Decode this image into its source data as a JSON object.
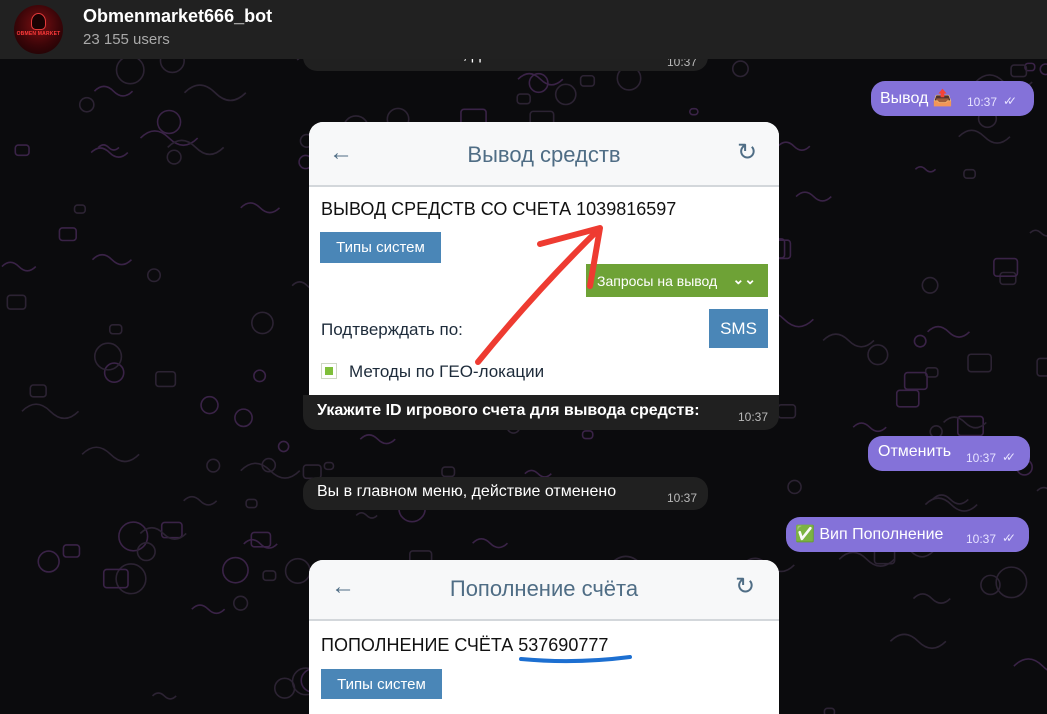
{
  "header": {
    "chat_title": "Obmenmarket666_bot",
    "members": "23 155 users",
    "avatar_text": "OBMEN MARKET"
  },
  "messages": {
    "m0_partial": "Вы в главном меню, действие отменено",
    "m0_time": "10:37",
    "m1_text": "Вывод 📤",
    "m1_time": "10:37",
    "caption_text": "Укажите ID игрового счета для вывода средств:",
    "caption_time": "10:37",
    "m3_text": "Отменить",
    "m3_time": "10:37",
    "m4_text": "Вы в главном меню, действие отменено",
    "m4_time": "10:37",
    "m5_text": "✅ Вип Пополнение",
    "m5_time": "10:37"
  },
  "withdraw_screen": {
    "title": "Вывод средств",
    "heading": "ВЫВОД СРЕДСТВ СО СЧЕТА 1039816597",
    "types_button": "Типы систем",
    "requests_button": "Запросы на вывод",
    "confirm_label": "Подтверждать по:",
    "sms_button": "SMS",
    "geo_label": "Методы по ГЕО-локации"
  },
  "deposit_screen": {
    "title": "Пополнение счёта",
    "heading_prefix": "ПОПОЛНЕНИЕ СЧЁТА ",
    "account_id": "537690777",
    "types_button": "Типы систем"
  },
  "icons": {
    "back": "arrow-left-icon",
    "refresh": "refresh-icon",
    "chevron": "double-chevron-down-icon",
    "read_ticks": "double-check-icon"
  },
  "colors": {
    "outgoing_bubble": "#8472d9",
    "incoming_bubble": "#202020",
    "header_bg": "#212121",
    "annotation_red": "#ee3b31",
    "underline_blue": "#1c6fd1"
  }
}
